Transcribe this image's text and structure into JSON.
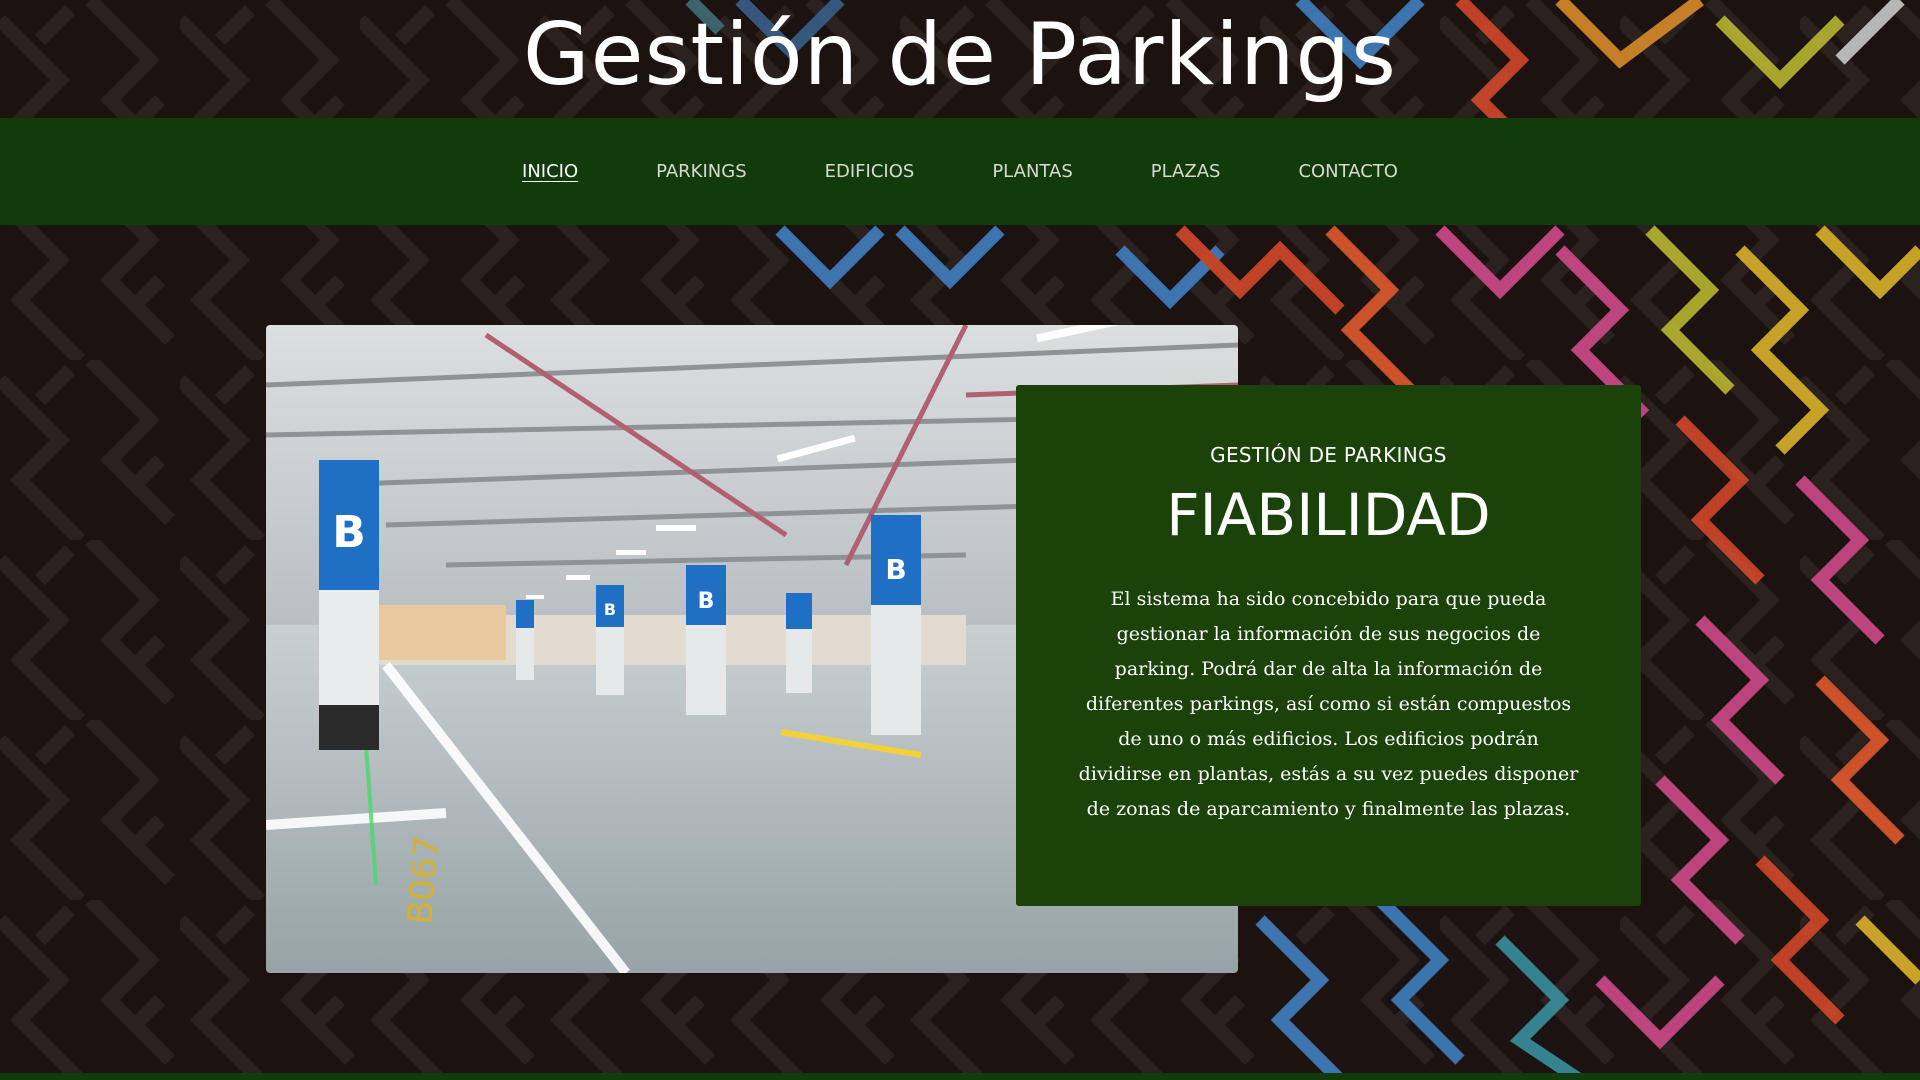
{
  "header": {
    "title": "Gestión de Parkings"
  },
  "nav": {
    "items": [
      {
        "label": "INICIO",
        "active": true
      },
      {
        "label": "PARKINGS",
        "active": false
      },
      {
        "label": "EDIFICIOS",
        "active": false
      },
      {
        "label": "PLANTAS",
        "active": false
      },
      {
        "label": "PLAZAS",
        "active": false
      },
      {
        "label": "CONTACTO",
        "active": false
      }
    ]
  },
  "hero": {
    "image_subject": "underground parking garage",
    "pillar_signs": [
      "B",
      "B",
      "B",
      "B"
    ],
    "floor_marking": "B067"
  },
  "card": {
    "kicker": "GESTIÓN DE PARKINGS",
    "title": "FIABILIDAD",
    "text": "El sistema ha sido concebido para que pueda gestionar la información de sus negocios de parking. Podrá dar de alta la información de diferentes parkings, así como si están compuestos de uno o más edificios. Los edificios podrán dividirse en plantas, estás a su vez puedes disponer de zonas de aparcamiento y finalmente las plazas."
  },
  "colors": {
    "page_background": "#1c1210",
    "nav_background": "#113b0b",
    "card_background": "#1b4209",
    "nav_text": "#d9d9cf",
    "pillar_blue": "#1f6fc4"
  }
}
